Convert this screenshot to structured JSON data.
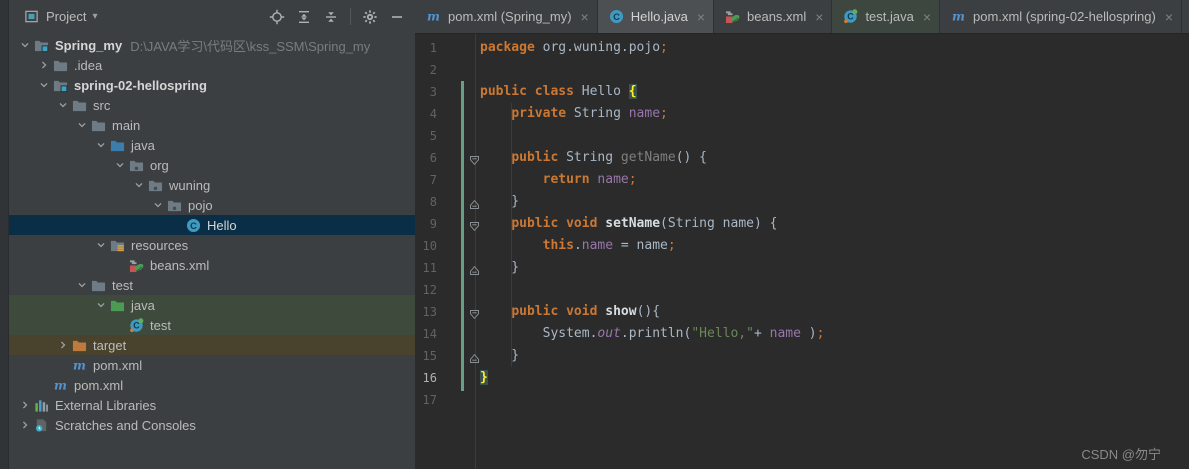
{
  "colors": {
    "panel_bg": "#3c3f41",
    "editor_bg": "#2b2b2b",
    "selected_row": "#0b2e47",
    "test_row_green": "#3e4a3c",
    "excluded_row_brown": "#49432e",
    "keyword_orange": "#cc7832",
    "string_green": "#6a8759",
    "field_purple": "#9876aa",
    "brace_match_yellow": "#ffef28",
    "class_icon_teal": "#3f99c0",
    "maven_blue": "#5394cf",
    "vcs_added_green": "#6b9e87"
  },
  "project_panel": {
    "title": "Project",
    "caret": "▾",
    "actions": [
      "locate",
      "expand-all",
      "collapse-all",
      "divider",
      "settings",
      "hide"
    ]
  },
  "tree": {
    "rows": [
      {
        "level": 0,
        "chevron": "down",
        "icon": "module-folder",
        "label": "Spring_my",
        "bold": true,
        "suffix": "D:\\JAVA学习\\代码区\\kss_SSM\\Spring_my",
        "bg": null
      },
      {
        "level": 1,
        "chevron": "right",
        "icon": "folder",
        "label": ".idea",
        "bg": null
      },
      {
        "level": 1,
        "chevron": "down",
        "icon": "module-folder",
        "label": "spring-02-hellospring",
        "bold": true,
        "bg": null
      },
      {
        "level": 2,
        "chevron": "down",
        "icon": "folder",
        "label": "src",
        "bg": null
      },
      {
        "level": 3,
        "chevron": "down",
        "icon": "folder",
        "label": "main",
        "bg": null
      },
      {
        "level": 4,
        "chevron": "down",
        "icon": "source-folder",
        "label": "java",
        "bg": null
      },
      {
        "level": 5,
        "chevron": "down",
        "icon": "package-folder",
        "label": "org",
        "bg": null
      },
      {
        "level": 6,
        "chevron": "down",
        "icon": "package-folder",
        "label": "wuning",
        "bg": null
      },
      {
        "level": 7,
        "chevron": "down",
        "icon": "package-folder",
        "label": "pojo",
        "bg": null
      },
      {
        "level": 8,
        "chevron": null,
        "icon": "class",
        "label": "Hello",
        "bg": "selected"
      },
      {
        "level": 4,
        "chevron": "down",
        "icon": "resources-folder",
        "label": "resources",
        "bg": null
      },
      {
        "level": 5,
        "chevron": null,
        "icon": "beans",
        "label": "beans.xml",
        "bg": null
      },
      {
        "level": 3,
        "chevron": "down",
        "icon": "folder",
        "label": "test",
        "bg": null
      },
      {
        "level": 4,
        "chevron": "down",
        "icon": "test-folder",
        "label": "java",
        "bg": "test"
      },
      {
        "level": 5,
        "chevron": null,
        "icon": "test-class",
        "label": "test",
        "bg": "test"
      },
      {
        "level": 2,
        "chevron": "right",
        "icon": "excluded-folder",
        "label": "target",
        "bg": "excluded"
      },
      {
        "level": 2,
        "chevron": null,
        "icon": "maven",
        "label": "pom.xml",
        "bg": null
      },
      {
        "level": 1,
        "chevron": null,
        "icon": "maven",
        "label": "pom.xml",
        "bg": null
      },
      {
        "level": 0,
        "chevron": "right",
        "icon": "libraries",
        "label": "External Libraries",
        "bg": null
      },
      {
        "level": 0,
        "chevron": "right",
        "icon": "scratches",
        "label": "Scratches and Consoles",
        "bg": null
      }
    ]
  },
  "tabs": {
    "close_glyph": "×",
    "items": [
      {
        "icon": "maven",
        "label": "pom.xml (Spring_my)",
        "active": false,
        "tint": null
      },
      {
        "icon": "class",
        "label": "Hello.java",
        "active": true,
        "tint": null
      },
      {
        "icon": "beans",
        "label": "beans.xml",
        "active": false,
        "tint": null
      },
      {
        "icon": "test-class",
        "label": "test.java",
        "active": false,
        "tint": "test"
      },
      {
        "icon": "maven",
        "label": "pom.xml (spring-02-hellospring)",
        "active": false,
        "tint": null
      }
    ]
  },
  "editor": {
    "lines": [
      {
        "n": 1,
        "fold": null,
        "cur": false,
        "t": [
          [
            "kw",
            "package"
          ],
          [
            "pl",
            " org.wuning.pojo"
          ],
          [
            "sm",
            ";"
          ]
        ]
      },
      {
        "n": 2,
        "fold": null,
        "cur": false,
        "t": []
      },
      {
        "n": 3,
        "fold": null,
        "cur": false,
        "t": [
          [
            "kw",
            "public"
          ],
          [
            "pl",
            " "
          ],
          [
            "kw",
            "class"
          ],
          [
            "pl",
            " Hello "
          ],
          [
            "bm",
            "{"
          ]
        ]
      },
      {
        "n": 4,
        "fold": null,
        "cur": false,
        "t": [
          [
            "pl",
            "    "
          ],
          [
            "kw",
            "private"
          ],
          [
            "pl",
            " String "
          ],
          [
            "fd",
            "name"
          ],
          [
            "sm",
            ";"
          ]
        ]
      },
      {
        "n": 5,
        "fold": null,
        "cur": false,
        "t": []
      },
      {
        "n": 6,
        "fold": "down",
        "cur": false,
        "t": [
          [
            "pl",
            "    "
          ],
          [
            "kw",
            "public"
          ],
          [
            "pl",
            " String "
          ],
          [
            "mu",
            "getName"
          ],
          [
            "pl",
            "() {"
          ]
        ]
      },
      {
        "n": 7,
        "fold": null,
        "cur": false,
        "t": [
          [
            "pl",
            "        "
          ],
          [
            "kw",
            "return"
          ],
          [
            "pl",
            " "
          ],
          [
            "fd",
            "name"
          ],
          [
            "sm",
            ";"
          ]
        ]
      },
      {
        "n": 8,
        "fold": "up",
        "cur": false,
        "t": [
          [
            "pl",
            "    }"
          ]
        ]
      },
      {
        "n": 9,
        "fold": "down",
        "cur": false,
        "t": [
          [
            "pl",
            "    "
          ],
          [
            "kw",
            "public"
          ],
          [
            "pl",
            " "
          ],
          [
            "kw",
            "void"
          ],
          [
            "pl",
            " "
          ],
          [
            "md",
            "setName"
          ],
          [
            "pl",
            "(String name) {"
          ]
        ]
      },
      {
        "n": 10,
        "fold": null,
        "cur": false,
        "t": [
          [
            "pl",
            "        "
          ],
          [
            "kw",
            "this"
          ],
          [
            "pl",
            "."
          ],
          [
            "fd",
            "name"
          ],
          [
            "pl",
            " = name"
          ],
          [
            "sm",
            ";"
          ]
        ]
      },
      {
        "n": 11,
        "fold": "up",
        "cur": false,
        "t": [
          [
            "pl",
            "    }"
          ]
        ]
      },
      {
        "n": 12,
        "fold": null,
        "cur": false,
        "t": []
      },
      {
        "n": 13,
        "fold": "down",
        "cur": false,
        "t": [
          [
            "pl",
            "    "
          ],
          [
            "kw",
            "public"
          ],
          [
            "pl",
            " "
          ],
          [
            "kw",
            "void"
          ],
          [
            "pl",
            " "
          ],
          [
            "md",
            "show"
          ],
          [
            "pl",
            "(){"
          ]
        ]
      },
      {
        "n": 14,
        "fold": null,
        "cur": false,
        "t": [
          [
            "pl",
            "        System."
          ],
          [
            "sf",
            "out"
          ],
          [
            "pl",
            ".println("
          ],
          [
            "st",
            "\"Hello,\""
          ],
          [
            "pl",
            "+ "
          ],
          [
            "fd",
            "name"
          ],
          [
            "pl",
            " )"
          ],
          [
            "sm",
            ";"
          ]
        ]
      },
      {
        "n": 15,
        "fold": "up",
        "cur": false,
        "t": [
          [
            "pl",
            "    }"
          ]
        ]
      },
      {
        "n": 16,
        "fold": null,
        "cur": true,
        "t": [
          [
            "bm",
            "}"
          ]
        ]
      },
      {
        "n": 17,
        "fold": null,
        "cur": false,
        "t": []
      }
    ]
  },
  "watermark": "CSDN @勿宁"
}
